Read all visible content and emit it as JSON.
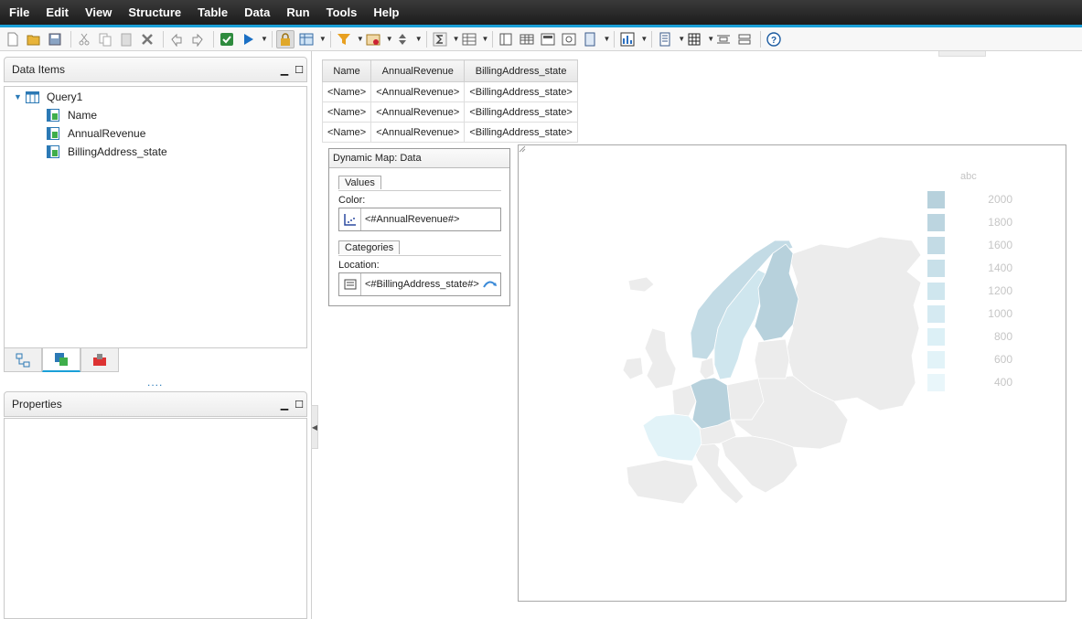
{
  "menu": [
    "File",
    "Edit",
    "View",
    "Structure",
    "Table",
    "Data",
    "Run",
    "Tools",
    "Help"
  ],
  "toolbar_icons": [
    "new-icon",
    "open-icon",
    "save-icon",
    "cut-icon",
    "copy-icon",
    "paste-icon",
    "delete-icon",
    "undo-icon",
    "redo-icon",
    "validate-icon",
    "run-icon",
    "lock-icon",
    "query-icon",
    "filter-icon",
    "calc-icon",
    "sort-icon",
    "sum-icon",
    "group-icon",
    "panel-icon",
    "table-icon",
    "layout-icon",
    "refresh-icon",
    "page-icon",
    "chart-icon",
    "report-icon",
    "grid-icon",
    "insert-row-icon",
    "delete-row-icon",
    "help-icon"
  ],
  "data_items": {
    "title": "Data Items",
    "query": "Query1",
    "fields": [
      "Name",
      "AnnualRevenue",
      "BillingAddress_state"
    ]
  },
  "properties": {
    "title": "Properties"
  },
  "grid": {
    "headers": [
      "Name",
      "AnnualRevenue",
      "BillingAddress_state"
    ],
    "rows": [
      [
        "<Name>",
        "<AnnualRevenue>",
        "<BillingAddress_state>"
      ],
      [
        "<Name>",
        "<AnnualRevenue>",
        "<BillingAddress_state>"
      ],
      [
        "<Name>",
        "<AnnualRevenue>",
        "<BillingAddress_state>"
      ]
    ]
  },
  "dynamic_map": {
    "title": "Dynamic Map: Data",
    "values_section": "Values",
    "color_label": "Color:",
    "color_value": "<#AnnualRevenue#>",
    "categories_section": "Categories",
    "location_label": "Location:",
    "location_value": "<#BillingAddress_state#>"
  },
  "map": {
    "legend_title": "abc",
    "legend": [
      {
        "value": "2000",
        "color": "#b7d1dc"
      },
      {
        "value": "1800",
        "color": "#bcd5e0"
      },
      {
        "value": "1600",
        "color": "#c3dbe5"
      },
      {
        "value": "1400",
        "color": "#c8e0e9"
      },
      {
        "value": "1200",
        "color": "#cfe6ee"
      },
      {
        "value": "1000",
        "color": "#d5eaf2"
      },
      {
        "value": "800",
        "color": "#dcf0f6"
      },
      {
        "value": "600",
        "color": "#e2f3f8"
      },
      {
        "value": "400",
        "color": "#e9f6fa"
      }
    ],
    "region_colors": {
      "base": "#ececec",
      "finland": "#b7d1dc",
      "sweden": "#cfe6ee",
      "norway": "#c3dbe5",
      "germany": "#b7d1dc",
      "france": "#e2f3f8"
    }
  }
}
